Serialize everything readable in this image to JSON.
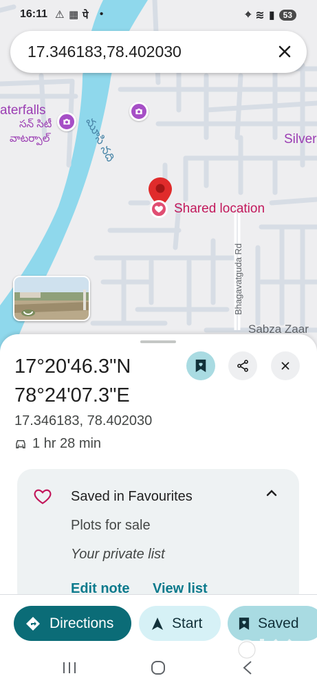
{
  "status_bar": {
    "time": "16:11",
    "indicator_char": "पे",
    "battery": "53"
  },
  "search": {
    "query": "17.346183,78.402030"
  },
  "map": {
    "poi_waterfalls_en": "aterfalls",
    "poi_waterfalls_te": "సన్ సిటీ",
    "poi_waterfalls_te2": "వాటర్పాల్",
    "river_label": "మూసి నది",
    "poi_right": "Silver",
    "shared_location_label": "Shared location",
    "road_label": "Bhagavatguda Rd",
    "area_label": "Sabza Zaar"
  },
  "place": {
    "title_line1": "17°20'46.3\"N",
    "title_line2": "78°24'07.3\"E",
    "coordinates": "17.346183, 78.402030",
    "drive_time": "1 hr 28 min"
  },
  "saved_card": {
    "title": "Saved in Favourites",
    "list_name": "Plots for sale",
    "privacy": "Your private list",
    "edit_note": "Edit note",
    "view_list": "View list"
  },
  "actions": {
    "directions": "Directions",
    "start": "Start",
    "saved": "Saved"
  },
  "watermark": "olx",
  "colors": {
    "river": "#8fd8ec",
    "map_bg": "#eeeef0",
    "road": "#d7dde5",
    "poi": "#a64fc6",
    "pin_red": "#e02b2b",
    "shared_pink": "#e04e72",
    "primary": "#0b6c77",
    "link": "#0b7a8c"
  }
}
